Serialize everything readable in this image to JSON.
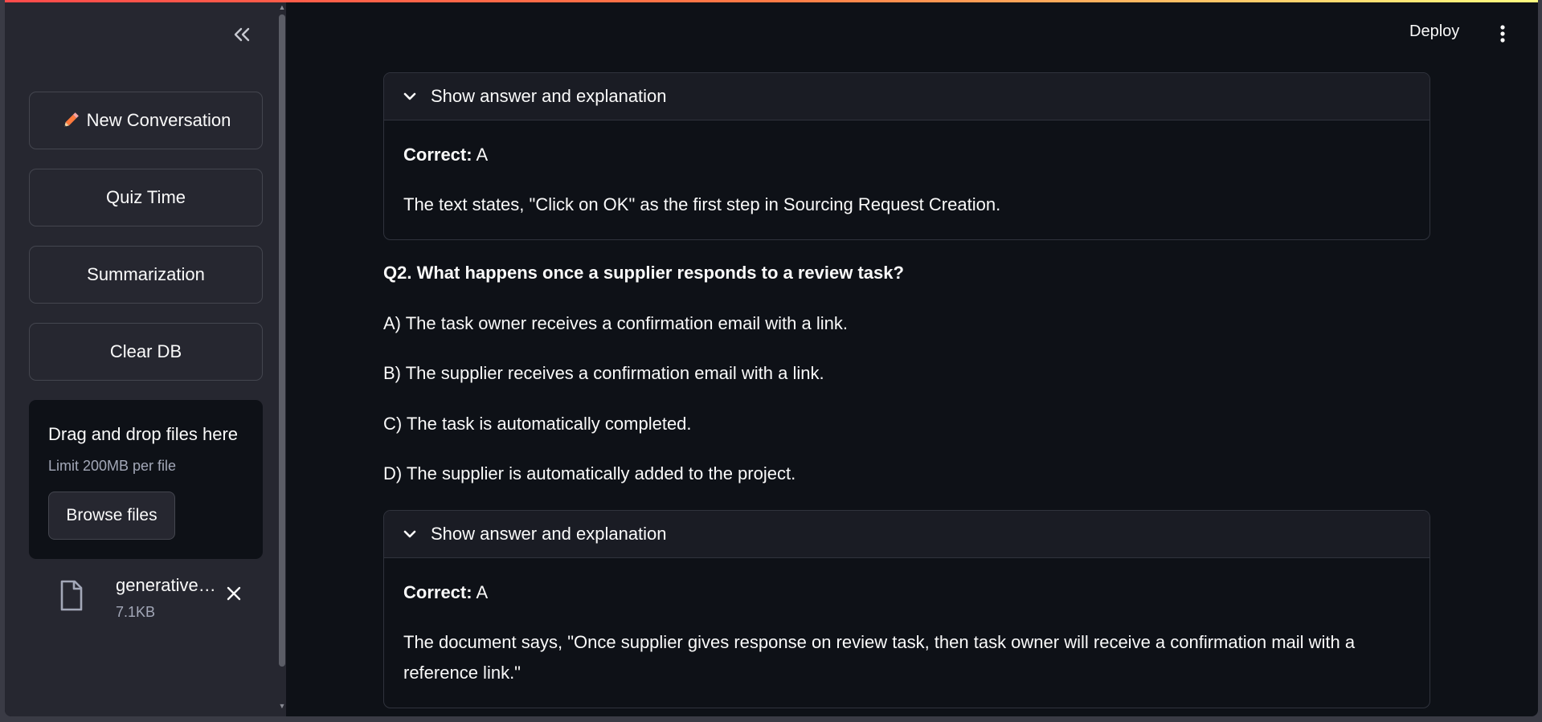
{
  "sidebar": {
    "buttons": {
      "new_conversation": "New Conversation",
      "quiz_time": "Quiz Time",
      "summarization": "Summarization",
      "clear_db": "Clear DB"
    },
    "uploader": {
      "title": "Drag and drop files here",
      "limit": "Limit 200MB per file",
      "browse_label": "Browse files"
    },
    "file": {
      "name": "generative…",
      "size": "7.1KB"
    }
  },
  "header": {
    "deploy_label": "Deploy"
  },
  "main": {
    "expander1": {
      "header": "Show answer and explanation",
      "correct_label": "Correct:",
      "correct_value": " A",
      "explanation": "The text states, \"Click on OK\" as the first step in Sourcing Request Creation."
    },
    "question": {
      "title": "Q2. What happens once a supplier responds to a review task?",
      "options": [
        "A) The task owner receives a confirmation email with a link.",
        "B) The supplier receives a confirmation email with a link.",
        "C) The task is automatically completed.",
        "D) The supplier is automatically added to the project."
      ]
    },
    "expander2": {
      "header": "Show answer and explanation",
      "correct_label": "Correct:",
      "correct_value": " A",
      "explanation": "The document says, \"Once supplier gives response on review task, then task owner will receive a confirmation mail with a reference link.\""
    }
  },
  "colors": {
    "app_bg": "#0e1117",
    "sidebar_bg": "#262730",
    "expander_header_bg": "#1a1c24",
    "border": "#30333d",
    "text": "#fafafa",
    "muted": "#a3a8b8",
    "pencil": "#ff7a3d"
  }
}
